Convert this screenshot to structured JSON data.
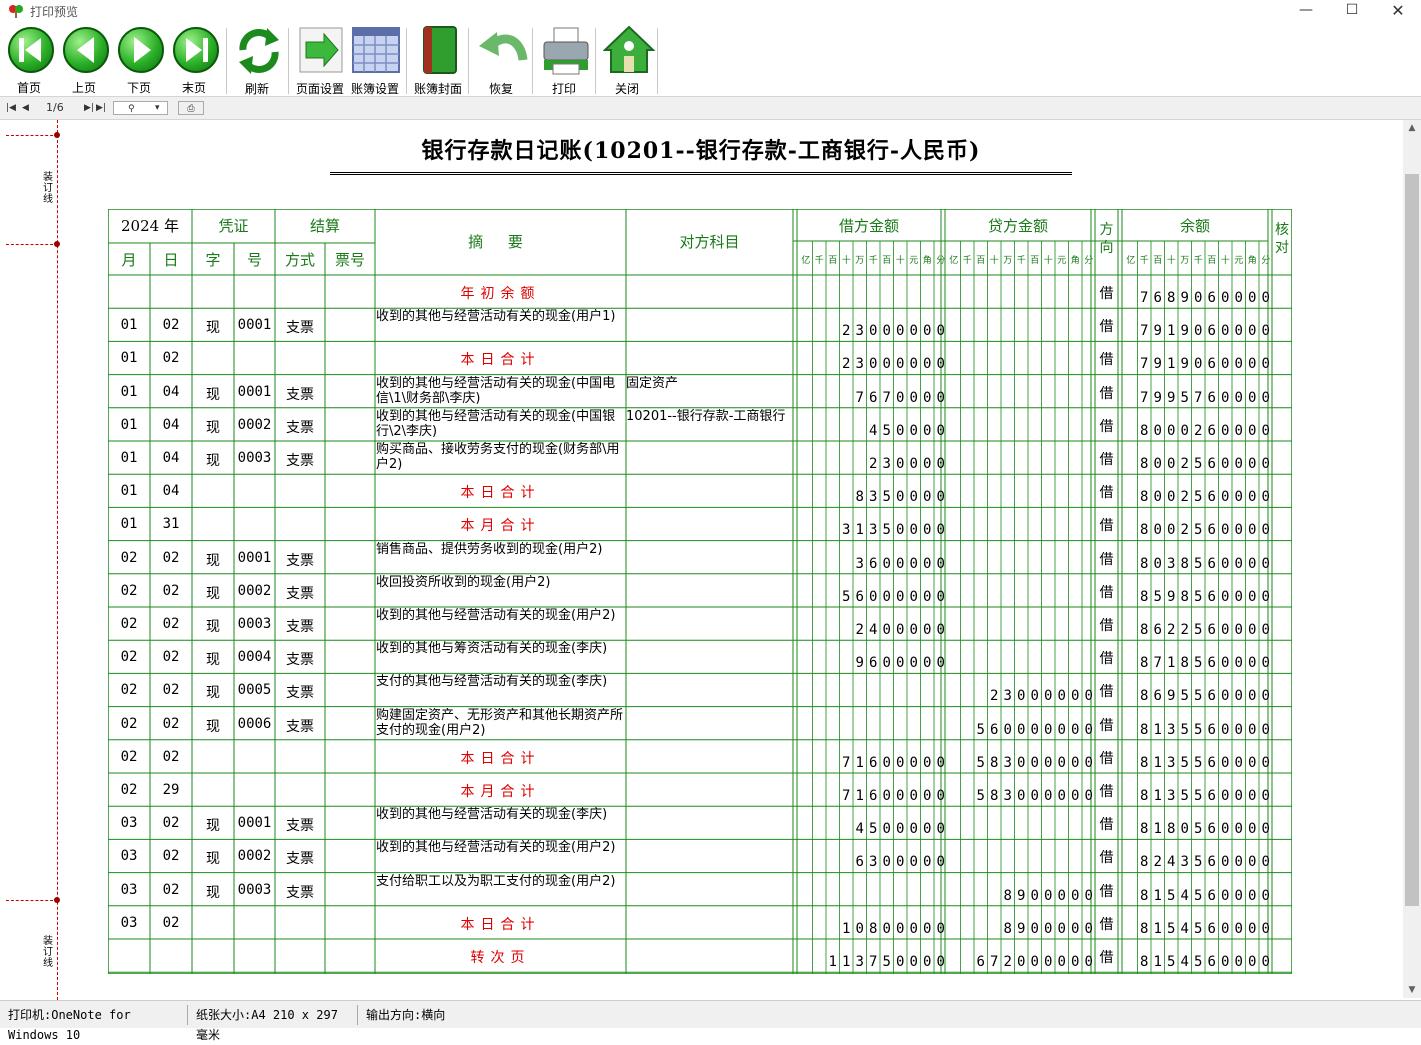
{
  "window": {
    "title": "打印预览"
  },
  "toolbar": {
    "first": "首页",
    "prev": "上页",
    "next": "下页",
    "last": "末页",
    "refresh": "刷新",
    "page_setup": "页面设置",
    "book_setup": "账簿设置",
    "cover": "账簿封面",
    "restore": "恢复",
    "print": "打印",
    "close": "关闭"
  },
  "nav": {
    "page": "1/6"
  },
  "binding": {
    "label": "装订线"
  },
  "document": {
    "title": "银行存款日记账(10201--银行存款-工商银行-人民币)"
  },
  "headers": {
    "year": "2024 年",
    "voucher": "凭证",
    "settle": "结算",
    "summary": "摘 要",
    "opposite": "对方科目",
    "debit": "借方金额",
    "credit": "贷方金额",
    "direction": "方向",
    "balance": "余额",
    "check": "核对",
    "month": "月",
    "day": "日",
    "zi": "字",
    "hao": "号",
    "method": "方式",
    "ticket": "票号",
    "digits": [
      "亿",
      "千",
      "百",
      "十",
      "万",
      "千",
      "百",
      "十",
      "元",
      "角",
      "分"
    ]
  },
  "rows": [
    {
      "m": "",
      "d": "",
      "zi": "",
      "no": "",
      "way": "",
      "summary": "年初余额",
      "special": true,
      "opp": "",
      "debit": "",
      "credit": "",
      "dir": "借",
      "bal": "7689060000"
    },
    {
      "m": "01",
      "d": "02",
      "zi": "现",
      "no": "0001",
      "way": "支票",
      "summary": "收到的其他与经营活动有关的现金(用户1)",
      "special": false,
      "opp": "",
      "debit": "23000000",
      "credit": "",
      "dir": "借",
      "bal": "7919060000"
    },
    {
      "m": "01",
      "d": "02",
      "zi": "",
      "no": "",
      "way": "",
      "summary": "本日合计",
      "special": true,
      "opp": "",
      "debit": "23000000",
      "credit": "",
      "dir": "借",
      "bal": "7919060000"
    },
    {
      "m": "01",
      "d": "04",
      "zi": "现",
      "no": "0001",
      "way": "支票",
      "summary": "收到的其他与经营活动有关的现金(中国电信\\1\\财务部\\李庆)",
      "special": false,
      "opp": "固定资产",
      "debit": "7670000",
      "credit": "",
      "dir": "借",
      "bal": "7995760000"
    },
    {
      "m": "01",
      "d": "04",
      "zi": "现",
      "no": "0002",
      "way": "支票",
      "summary": "收到的其他与经营活动有关的现金(中国银行\\2\\李庆)",
      "special": false,
      "opp": "10201--银行存款-工商银行",
      "debit": "450000",
      "credit": "",
      "dir": "借",
      "bal": "8000260000"
    },
    {
      "m": "01",
      "d": "04",
      "zi": "现",
      "no": "0003",
      "way": "支票",
      "summary": "购买商品、接收劳务支付的现金(财务部\\用户2)",
      "special": false,
      "opp": "",
      "debit": "230000",
      "credit": "",
      "dir": "借",
      "bal": "8002560000"
    },
    {
      "m": "01",
      "d": "04",
      "zi": "",
      "no": "",
      "way": "",
      "summary": "本日合计",
      "special": true,
      "opp": "",
      "debit": "8350000",
      "credit": "",
      "dir": "借",
      "bal": "8002560000"
    },
    {
      "m": "01",
      "d": "31",
      "zi": "",
      "no": "",
      "way": "",
      "summary": "本月合计",
      "special": true,
      "opp": "",
      "debit": "31350000",
      "credit": "",
      "dir": "借",
      "bal": "8002560000"
    },
    {
      "m": "02",
      "d": "02",
      "zi": "现",
      "no": "0001",
      "way": "支票",
      "summary": "销售商品、提供劳务收到的现金(用户2)",
      "special": false,
      "opp": "",
      "debit": "3600000",
      "credit": "",
      "dir": "借",
      "bal": "8038560000"
    },
    {
      "m": "02",
      "d": "02",
      "zi": "现",
      "no": "0002",
      "way": "支票",
      "summary": "收回投资所收到的现金(用户2)",
      "special": false,
      "opp": "",
      "debit": "56000000",
      "credit": "",
      "dir": "借",
      "bal": "8598560000"
    },
    {
      "m": "02",
      "d": "02",
      "zi": "现",
      "no": "0003",
      "way": "支票",
      "summary": "收到的其他与经营活动有关的现金(用户2)",
      "special": false,
      "opp": "",
      "debit": "2400000",
      "credit": "",
      "dir": "借",
      "bal": "8622560000"
    },
    {
      "m": "02",
      "d": "02",
      "zi": "现",
      "no": "0004",
      "way": "支票",
      "summary": "收到的其他与筹资活动有关的现金(李庆)",
      "special": false,
      "opp": "",
      "debit": "9600000",
      "credit": "",
      "dir": "借",
      "bal": "8718560000"
    },
    {
      "m": "02",
      "d": "02",
      "zi": "现",
      "no": "0005",
      "way": "支票",
      "summary": "支付的其他与经营活动有关的现金(李庆)",
      "special": false,
      "opp": "",
      "debit": "",
      "credit": "23000000",
      "dir": "借",
      "bal": "8695560000"
    },
    {
      "m": "02",
      "d": "02",
      "zi": "现",
      "no": "0006",
      "way": "支票",
      "summary": "购建固定资产、无形资产和其他长期资产所支付的现金(用户2)",
      "special": false,
      "opp": "",
      "debit": "",
      "credit": "560000000",
      "dir": "借",
      "bal": "8135560000"
    },
    {
      "m": "02",
      "d": "02",
      "zi": "",
      "no": "",
      "way": "",
      "summary": "本日合计",
      "special": true,
      "opp": "",
      "debit": "71600000",
      "credit": "583000000",
      "dir": "借",
      "bal": "8135560000"
    },
    {
      "m": "02",
      "d": "29",
      "zi": "",
      "no": "",
      "way": "",
      "summary": "本月合计",
      "special": true,
      "opp": "",
      "debit": "71600000",
      "credit": "583000000",
      "dir": "借",
      "bal": "8135560000"
    },
    {
      "m": "03",
      "d": "02",
      "zi": "现",
      "no": "0001",
      "way": "支票",
      "summary": "收到的其他与经营活动有关的现金(李庆)",
      "special": false,
      "opp": "",
      "debit": "4500000",
      "credit": "",
      "dir": "借",
      "bal": "8180560000"
    },
    {
      "m": "03",
      "d": "02",
      "zi": "现",
      "no": "0002",
      "way": "支票",
      "summary": "收到的其他与经营活动有关的现金(用户2)",
      "special": false,
      "opp": "",
      "debit": "6300000",
      "credit": "",
      "dir": "借",
      "bal": "8243560000"
    },
    {
      "m": "03",
      "d": "02",
      "zi": "现",
      "no": "0003",
      "way": "支票",
      "summary": "支付给职工以及为职工支付的现金(用户2)",
      "special": false,
      "opp": "",
      "debit": "",
      "credit": "8900000",
      "dir": "借",
      "bal": "8154560000"
    },
    {
      "m": "03",
      "d": "02",
      "zi": "",
      "no": "",
      "way": "",
      "summary": "本日合计",
      "special": true,
      "opp": "",
      "debit": "10800000",
      "credit": "8900000",
      "dir": "借",
      "bal": "8154560000"
    },
    {
      "m": "",
      "d": "",
      "zi": "",
      "no": "",
      "way": "",
      "summary": "转次页",
      "special": true,
      "opp": "",
      "debit": "113750000",
      "credit": "672000000",
      "dir": "借",
      "bal": "8154560000"
    }
  ],
  "status": {
    "printer": "打印机:OneNote for Windows 10",
    "paper": "纸张大小:A4 210 x 297 毫米",
    "orientation": "输出方向:横向"
  },
  "colors": {
    "grid": "#1a8a1a",
    "header_text": "#1a7a1a",
    "special_text": "#e00000"
  }
}
